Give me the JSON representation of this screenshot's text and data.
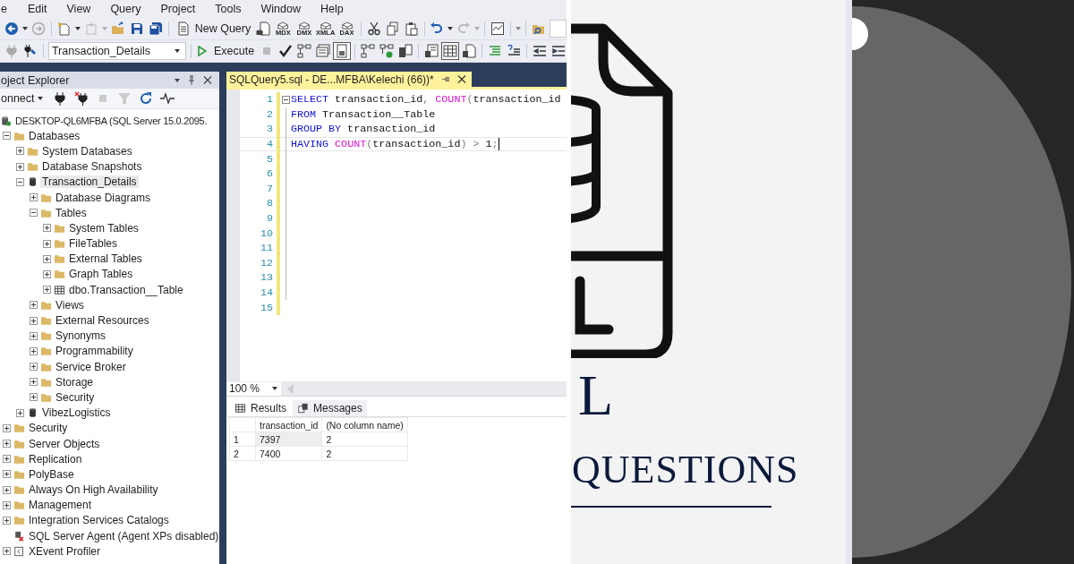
{
  "menu_bar": {
    "items": [
      "e",
      "Edit",
      "View",
      "Query",
      "Project",
      "Tools",
      "Window",
      "Help"
    ]
  },
  "toolbar": {
    "new_query": "New Query",
    "query_types": [
      "MDX",
      "DMX",
      "XMLA",
      "DAX"
    ]
  },
  "sql_toolbar": {
    "database": "Transaction_Details",
    "execute": "Execute"
  },
  "object_explorer": {
    "title": "oject Explorer",
    "connect": "onnect",
    "tree": [
      {
        "label": "DESKTOP-QL6MFBA (SQL Server 15.0.2095.",
        "kind": "server",
        "selected": false,
        "children": [
          {
            "label": "Databases",
            "kind": "folder",
            "expanded": true,
            "selected": false,
            "children": [
              {
                "label": "System Databases",
                "kind": "folder",
                "expanded": false,
                "selected": false
              },
              {
                "label": "Database Snapshots",
                "kind": "folder",
                "expanded": false,
                "selected": false
              },
              {
                "label": "Transaction_Details",
                "kind": "database",
                "expanded": true,
                "selected": true,
                "children": [
                  {
                    "label": "Database Diagrams",
                    "kind": "folder",
                    "expanded": false,
                    "selected": false
                  },
                  {
                    "label": "Tables",
                    "kind": "folder",
                    "expanded": true,
                    "selected": false,
                    "children": [
                      {
                        "label": "System Tables",
                        "kind": "folder",
                        "expanded": false,
                        "selected": false
                      },
                      {
                        "label": "FileTables",
                        "kind": "folder",
                        "expanded": false,
                        "selected": false
                      },
                      {
                        "label": "External Tables",
                        "kind": "folder",
                        "expanded": false,
                        "selected": false
                      },
                      {
                        "label": "Graph Tables",
                        "kind": "folder",
                        "expanded": false,
                        "selected": false
                      },
                      {
                        "label": "dbo.Transaction__Table",
                        "kind": "table",
                        "expanded": false,
                        "selected": false
                      }
                    ]
                  },
                  {
                    "label": "Views",
                    "kind": "folder",
                    "expanded": false,
                    "selected": false
                  },
                  {
                    "label": "External Resources",
                    "kind": "folder",
                    "expanded": false,
                    "selected": false
                  },
                  {
                    "label": "Synonyms",
                    "kind": "folder",
                    "expanded": false,
                    "selected": false
                  },
                  {
                    "label": "Programmability",
                    "kind": "folder",
                    "expanded": false,
                    "selected": false
                  },
                  {
                    "label": "Service Broker",
                    "kind": "folder",
                    "expanded": false,
                    "selected": false
                  },
                  {
                    "label": "Storage",
                    "kind": "folder",
                    "expanded": false,
                    "selected": false
                  },
                  {
                    "label": "Security",
                    "kind": "folder",
                    "expanded": false,
                    "selected": false
                  }
                ]
              },
              {
                "label": "VibezLogistics",
                "kind": "database",
                "expanded": false,
                "selected": false
              }
            ]
          },
          {
            "label": "Security",
            "kind": "folder",
            "expanded": false,
            "selected": false
          },
          {
            "label": "Server Objects",
            "kind": "folder",
            "expanded": false,
            "selected": false
          },
          {
            "label": "Replication",
            "kind": "folder",
            "expanded": false,
            "selected": false
          },
          {
            "label": "PolyBase",
            "kind": "folder",
            "expanded": false,
            "selected": false
          },
          {
            "label": "Always On High Availability",
            "kind": "folder",
            "expanded": false,
            "selected": false
          },
          {
            "label": "Management",
            "kind": "folder",
            "expanded": false,
            "selected": false
          },
          {
            "label": "Integration Services Catalogs",
            "kind": "folder",
            "expanded": false,
            "selected": false
          },
          {
            "label": "SQL Server Agent (Agent XPs disabled)",
            "kind": "agent",
            "selected": false
          },
          {
            "label": "XEvent Profiler",
            "kind": "profiler",
            "expanded": false,
            "selected": false
          }
        ]
      }
    ]
  },
  "editor": {
    "tab": "SQLQuery5.sql - DE...MFBA\\Kelechi (66))*",
    "lines": [
      {
        "number": "1",
        "tokens": [
          {
            "kind": "keyword",
            "text": "SELECT"
          },
          {
            "kind": "plain",
            "text": " transaction_id"
          },
          {
            "kind": "operator",
            "text": ","
          },
          {
            "kind": "function",
            "text": " COUNT"
          },
          {
            "kind": "operator",
            "text": "("
          },
          {
            "kind": "plain",
            "text": "transaction_id"
          }
        ]
      },
      {
        "number": "2",
        "tokens": [
          {
            "kind": "keyword",
            "text": "FROM"
          },
          {
            "kind": "plain",
            "text": " Transaction__Table"
          }
        ]
      },
      {
        "number": "3",
        "tokens": [
          {
            "kind": "keyword",
            "text": "GROUP BY"
          },
          {
            "kind": "plain",
            "text": " transaction_id"
          }
        ]
      },
      {
        "number": "4",
        "current": true,
        "tokens": [
          {
            "kind": "keyword",
            "text": "HAVING"
          },
          {
            "kind": "function",
            "text": " COUNT"
          },
          {
            "kind": "operator",
            "text": "("
          },
          {
            "kind": "plain",
            "text": "transaction_id"
          },
          {
            "kind": "operator",
            "text": ")"
          },
          {
            "kind": "operator",
            "text": " >"
          },
          {
            "kind": "plain",
            "text": " 1"
          },
          {
            "kind": "operator",
            "text": ";"
          }
        ]
      },
      {
        "number": "5"
      },
      {
        "number": "6"
      },
      {
        "number": "7"
      },
      {
        "number": "8"
      },
      {
        "number": "9"
      },
      {
        "number": "10"
      },
      {
        "number": "11"
      },
      {
        "number": "12"
      },
      {
        "number": "13"
      },
      {
        "number": "14"
      },
      {
        "number": "15"
      }
    ],
    "zoom": "100 %"
  },
  "results": {
    "tabs": [
      {
        "label": "Results",
        "selected": true
      },
      {
        "label": "Messages",
        "selected": false
      }
    ],
    "columns": [
      "transaction_id",
      "(No column name)"
    ],
    "rows": [
      {
        "number": "1",
        "cells": [
          {
            "text": "7397",
            "selected": true
          },
          {
            "text": "2",
            "selected": false
          }
        ]
      },
      {
        "number": "2",
        "cells": [
          {
            "text": "7400",
            "selected": false
          },
          {
            "text": "2",
            "selected": false
          }
        ]
      }
    ]
  },
  "graphic": {
    "letter": "L",
    "word": "QUESTIONS"
  }
}
